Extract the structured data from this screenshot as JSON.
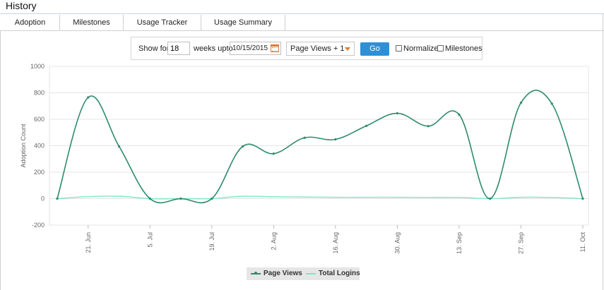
{
  "header": {
    "title": "History"
  },
  "tabs": [
    {
      "label": "Adoption",
      "active": true
    },
    {
      "label": "Milestones",
      "active": false
    },
    {
      "label": "Usage Tracker",
      "active": false
    },
    {
      "label": "Usage Summary",
      "active": false
    }
  ],
  "controls": {
    "show_for_label": "Show for",
    "weeks_value": "18",
    "weeks_upto_label": "weeks upto",
    "date_value": "10/15/2015",
    "metric_select": "Page Views + 1",
    "go_label": "Go",
    "normalize_label": "Normalize",
    "milestones_label": "Milestones",
    "normalize_checked": false,
    "milestones_checked": false
  },
  "colors": {
    "accent": "#2f8fd6",
    "page_views": "#2e8b6a",
    "total_logins": "#7fe6c8",
    "calendar": "#e07a2f"
  },
  "chart_data": {
    "type": "line",
    "ylabel": "Adoption Count",
    "xlabel": "",
    "ylim": [
      -200,
      1000
    ],
    "y_ticks": [
      "1000",
      "800",
      "600",
      "400",
      "200",
      "0",
      "-200"
    ],
    "x_tick_labels": [
      "21. Jun",
      "5. Jul",
      "19. Jul",
      "2. Aug",
      "16. Aug",
      "30. Aug",
      "13. Sep",
      "27. Sep",
      "11. Oct"
    ],
    "x_tick_dates": [
      "2015-06-21",
      "2015-07-05",
      "2015-07-19",
      "2015-08-02",
      "2015-08-16",
      "2015-08-30",
      "2015-09-13",
      "2015-09-27",
      "2015-10-11"
    ],
    "x": [
      "2015-06-14",
      "2015-06-21",
      "2015-06-28",
      "2015-07-05",
      "2015-07-12",
      "2015-07-19",
      "2015-07-26",
      "2015-08-02",
      "2015-08-09",
      "2015-08-16",
      "2015-08-23",
      "2015-08-30",
      "2015-09-06",
      "2015-09-13",
      "2015-09-20",
      "2015-09-27",
      "2015-10-04",
      "2015-10-11"
    ],
    "series": [
      {
        "name": "Page Views",
        "values": [
          0,
          765,
          395,
          0,
          0,
          0,
          395,
          340,
          460,
          448,
          550,
          645,
          548,
          635,
          0,
          725,
          718,
          0
        ]
      },
      {
        "name": "Total Logins",
        "values": [
          0,
          15,
          18,
          0,
          0,
          0,
          18,
          14,
          12,
          10,
          10,
          10,
          9,
          9,
          0,
          10,
          9,
          0
        ]
      }
    ],
    "legend_position": "bottom-center",
    "grid": true
  }
}
